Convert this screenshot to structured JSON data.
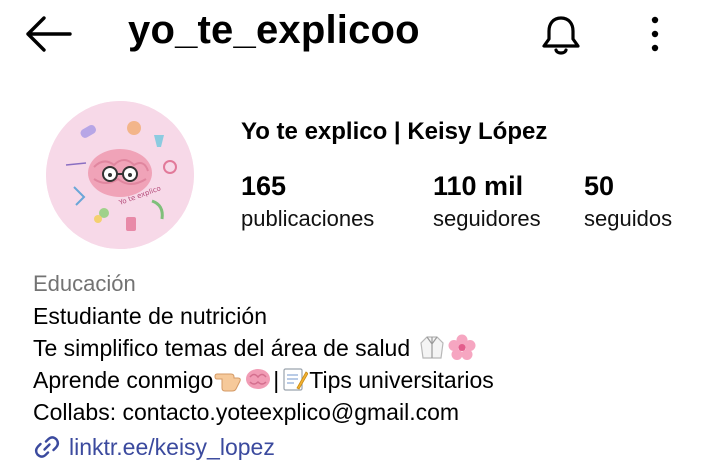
{
  "header": {
    "username": "yo_te_explicoo",
    "back_icon": "arrow-left-icon",
    "notifications_icon": "bell-icon",
    "more_icon": "more-vertical-icon"
  },
  "profile": {
    "display_name": "Yo te explico | Keisy López",
    "stats": [
      {
        "value": "165",
        "label": "publicaciones"
      },
      {
        "value": "110 mil",
        "label": "seguidores"
      },
      {
        "value": "50",
        "label": "seguidos"
      }
    ]
  },
  "bio": {
    "category": "Educación",
    "line1": "Estudiante de nutrición",
    "line2": "Te simplifico temas del área de salud",
    "line3_a": "Aprende conmigo",
    "line3_sep": "|",
    "line3_b": "Tips universitarios",
    "line4": "Collabs: contacto.yoteexplico@gmail.com",
    "link": "linktr.ee/keisy_lopez",
    "emojis": [
      "lab-coat-emoji",
      "cherry-blossom-emoji",
      "pointing-hand-emoji",
      "brain-emoji",
      "memo-emoji"
    ]
  },
  "colors": {
    "link": "#3b4a9e",
    "category": "#737373",
    "avatar_bg": "#f7d9e8"
  }
}
